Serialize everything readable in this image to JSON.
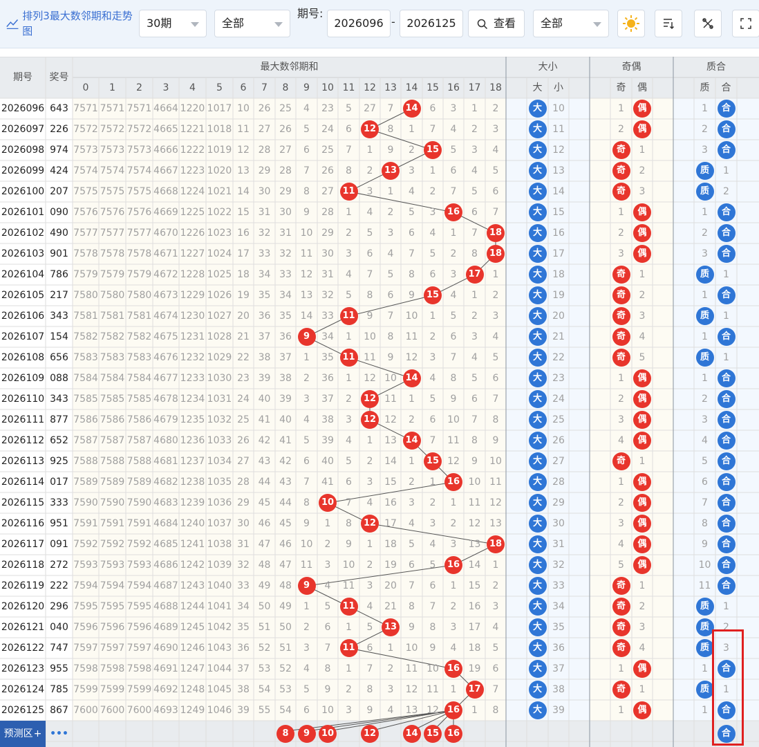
{
  "toolbar": {
    "title": "排列3最大数邻期和走势图",
    "period_select": "30期",
    "filter_select": "全部",
    "issue_label": "期号:",
    "issue_from": "2026096",
    "issue_to": "2026125",
    "dash": "-",
    "query_button": "查看",
    "filter_select2": "全部",
    "icons": [
      "sun-icon",
      "filter-list-icon",
      "shuffle-icon",
      "fullscreen-icon"
    ]
  },
  "header": {
    "col_issue": "期号",
    "col_prize": "奖号",
    "group_sum": "最大数邻期和",
    "group_size": "大小",
    "group_parity": "奇偶",
    "group_prime": "质合",
    "sum_cols": [
      "0",
      "1",
      "2",
      "3",
      "4",
      "5",
      "6",
      "7",
      "8",
      "9",
      "10",
      "11",
      "12",
      "13",
      "14",
      "15",
      "16",
      "17",
      "18"
    ],
    "size_cols": [
      "大",
      "小"
    ],
    "parity_cols": [
      "奇",
      "偶"
    ],
    "prime_cols": [
      "质",
      "合"
    ]
  },
  "colors": {
    "red": "#e8352c",
    "blue": "#2f76d6",
    "accent": "#3a6fd2"
  },
  "rows": [
    {
      "issue": "2026096",
      "prize": "643",
      "sums": [
        "7571",
        "7571",
        "7571",
        "4664",
        "1220",
        "1017",
        "10",
        "26",
        "25",
        "4",
        "23",
        "5",
        "27",
        "7",
        "14",
        "6",
        "3",
        "1",
        "2"
      ],
      "hit": 14,
      "size": [
        "大",
        "10"
      ],
      "parity": [
        "1",
        "偶"
      ],
      "prime": [
        "1",
        "合"
      ]
    },
    {
      "issue": "2026097",
      "prize": "226",
      "sums": [
        "7572",
        "7572",
        "7572",
        "4665",
        "1221",
        "1018",
        "11",
        "27",
        "26",
        "5",
        "24",
        "6",
        "12",
        "8",
        "1",
        "7",
        "4",
        "2",
        "3"
      ],
      "hit": 12,
      "size": [
        "大",
        "11"
      ],
      "parity": [
        "2",
        "偶"
      ],
      "prime": [
        "2",
        "合"
      ]
    },
    {
      "issue": "2026098",
      "prize": "974",
      "sums": [
        "7573",
        "7573",
        "7573",
        "4666",
        "1222",
        "1019",
        "12",
        "28",
        "27",
        "6",
        "25",
        "7",
        "1",
        "9",
        "2",
        "15",
        "5",
        "3",
        "4"
      ],
      "hit": 15,
      "size": [
        "大",
        "12"
      ],
      "parity": [
        "奇",
        "1"
      ],
      "prime": [
        "3",
        "合"
      ]
    },
    {
      "issue": "2026099",
      "prize": "424",
      "sums": [
        "7574",
        "7574",
        "7574",
        "4667",
        "1223",
        "1020",
        "13",
        "29",
        "28",
        "7",
        "26",
        "8",
        "2",
        "13",
        "3",
        "1",
        "6",
        "4",
        "5"
      ],
      "hit": 13,
      "size": [
        "大",
        "13"
      ],
      "parity": [
        "奇",
        "2"
      ],
      "prime": [
        "质",
        "1"
      ]
    },
    {
      "issue": "2026100",
      "prize": "207",
      "sums": [
        "7575",
        "7575",
        "7575",
        "4668",
        "1224",
        "1021",
        "14",
        "30",
        "29",
        "8",
        "27",
        "11",
        "3",
        "1",
        "4",
        "2",
        "7",
        "5",
        "6"
      ],
      "hit": 11,
      "size": [
        "大",
        "14"
      ],
      "parity": [
        "奇",
        "3"
      ],
      "prime": [
        "质",
        "2"
      ]
    },
    {
      "issue": "2026101",
      "prize": "090",
      "sums": [
        "7576",
        "7576",
        "7576",
        "4669",
        "1225",
        "1022",
        "15",
        "31",
        "30",
        "9",
        "28",
        "1",
        "4",
        "2",
        "5",
        "3",
        "16",
        "6",
        "7"
      ],
      "hit": 16,
      "size": [
        "大",
        "15"
      ],
      "parity": [
        "1",
        "偶"
      ],
      "prime": [
        "1",
        "合"
      ]
    },
    {
      "issue": "2026102",
      "prize": "490",
      "sums": [
        "7577",
        "7577",
        "7577",
        "4670",
        "1226",
        "1023",
        "16",
        "32",
        "31",
        "10",
        "29",
        "2",
        "5",
        "3",
        "6",
        "4",
        "1",
        "7",
        "18"
      ],
      "hit": 18,
      "size": [
        "大",
        "16"
      ],
      "parity": [
        "2",
        "偶"
      ],
      "prime": [
        "2",
        "合"
      ]
    },
    {
      "issue": "2026103",
      "prize": "901",
      "sums": [
        "7578",
        "7578",
        "7578",
        "4671",
        "1227",
        "1024",
        "17",
        "33",
        "32",
        "11",
        "30",
        "3",
        "6",
        "4",
        "7",
        "5",
        "2",
        "8",
        "18"
      ],
      "hit": 18,
      "size": [
        "大",
        "17"
      ],
      "parity": [
        "3",
        "偶"
      ],
      "prime": [
        "3",
        "合"
      ]
    },
    {
      "issue": "2026104",
      "prize": "786",
      "sums": [
        "7579",
        "7579",
        "7579",
        "4672",
        "1228",
        "1025",
        "18",
        "34",
        "33",
        "12",
        "31",
        "4",
        "7",
        "5",
        "8",
        "6",
        "3",
        "17",
        "1"
      ],
      "hit": 17,
      "size": [
        "大",
        "18"
      ],
      "parity": [
        "奇",
        "1"
      ],
      "prime": [
        "质",
        "1"
      ]
    },
    {
      "issue": "2026105",
      "prize": "217",
      "sums": [
        "7580",
        "7580",
        "7580",
        "4673",
        "1229",
        "1026",
        "19",
        "35",
        "34",
        "13",
        "32",
        "5",
        "8",
        "6",
        "9",
        "15",
        "4",
        "1",
        "2"
      ],
      "hit": 15,
      "size": [
        "大",
        "19"
      ],
      "parity": [
        "奇",
        "2"
      ],
      "prime": [
        "1",
        "合"
      ]
    },
    {
      "issue": "2026106",
      "prize": "343",
      "sums": [
        "7581",
        "7581",
        "7581",
        "4674",
        "1230",
        "1027",
        "20",
        "36",
        "35",
        "14",
        "33",
        "11",
        "9",
        "7",
        "10",
        "1",
        "5",
        "2",
        "3"
      ],
      "hit": 11,
      "size": [
        "大",
        "20"
      ],
      "parity": [
        "奇",
        "3"
      ],
      "prime": [
        "质",
        "1"
      ]
    },
    {
      "issue": "2026107",
      "prize": "154",
      "sums": [
        "7582",
        "7582",
        "7582",
        "4675",
        "1231",
        "1028",
        "21",
        "37",
        "36",
        "9",
        "34",
        "1",
        "10",
        "8",
        "11",
        "2",
        "6",
        "3",
        "4"
      ],
      "hit": 9,
      "size": [
        "大",
        "21"
      ],
      "parity": [
        "奇",
        "4"
      ],
      "prime": [
        "1",
        "合"
      ]
    },
    {
      "issue": "2026108",
      "prize": "656",
      "sums": [
        "7583",
        "7583",
        "7583",
        "4676",
        "1232",
        "1029",
        "22",
        "38",
        "37",
        "1",
        "35",
        "11",
        "11",
        "9",
        "12",
        "3",
        "7",
        "4",
        "5"
      ],
      "hit": 11,
      "size": [
        "大",
        "22"
      ],
      "parity": [
        "奇",
        "5"
      ],
      "prime": [
        "质",
        "1"
      ]
    },
    {
      "issue": "2026109",
      "prize": "088",
      "sums": [
        "7584",
        "7584",
        "7584",
        "4677",
        "1233",
        "1030",
        "23",
        "39",
        "38",
        "2",
        "36",
        "1",
        "12",
        "10",
        "14",
        "4",
        "8",
        "5",
        "6"
      ],
      "hit": 14,
      "size": [
        "大",
        "23"
      ],
      "parity": [
        "1",
        "偶"
      ],
      "prime": [
        "1",
        "合"
      ]
    },
    {
      "issue": "2026110",
      "prize": "343",
      "sums": [
        "7585",
        "7585",
        "7585",
        "4678",
        "1234",
        "1031",
        "24",
        "40",
        "39",
        "3",
        "37",
        "2",
        "12",
        "11",
        "1",
        "5",
        "9",
        "6",
        "7"
      ],
      "hit": 12,
      "size": [
        "大",
        "24"
      ],
      "parity": [
        "2",
        "偶"
      ],
      "prime": [
        "2",
        "合"
      ]
    },
    {
      "issue": "2026111",
      "prize": "877",
      "sums": [
        "7586",
        "7586",
        "7586",
        "4679",
        "1235",
        "1032",
        "25",
        "41",
        "40",
        "4",
        "38",
        "3",
        "12",
        "12",
        "2",
        "6",
        "10",
        "7",
        "8"
      ],
      "hit": 12,
      "size": [
        "大",
        "25"
      ],
      "parity": [
        "3",
        "偶"
      ],
      "prime": [
        "3",
        "合"
      ]
    },
    {
      "issue": "2026112",
      "prize": "652",
      "sums": [
        "7587",
        "7587",
        "7587",
        "4680",
        "1236",
        "1033",
        "26",
        "42",
        "41",
        "5",
        "39",
        "4",
        "1",
        "13",
        "14",
        "7",
        "11",
        "8",
        "9"
      ],
      "hit": 14,
      "size": [
        "大",
        "26"
      ],
      "parity": [
        "4",
        "偶"
      ],
      "prime": [
        "4",
        "合"
      ]
    },
    {
      "issue": "2026113",
      "prize": "925",
      "sums": [
        "7588",
        "7588",
        "7588",
        "4681",
        "1237",
        "1034",
        "27",
        "43",
        "42",
        "6",
        "40",
        "5",
        "2",
        "14",
        "1",
        "15",
        "12",
        "9",
        "10"
      ],
      "hit": 15,
      "size": [
        "大",
        "27"
      ],
      "parity": [
        "奇",
        "1"
      ],
      "prime": [
        "5",
        "合"
      ]
    },
    {
      "issue": "2026114",
      "prize": "017",
      "sums": [
        "7589",
        "7589",
        "7589",
        "4682",
        "1238",
        "1035",
        "28",
        "44",
        "43",
        "7",
        "41",
        "6",
        "3",
        "15",
        "2",
        "1",
        "16",
        "10",
        "11"
      ],
      "hit": 16,
      "size": [
        "大",
        "28"
      ],
      "parity": [
        "1",
        "偶"
      ],
      "prime": [
        "6",
        "合"
      ]
    },
    {
      "issue": "2026115",
      "prize": "333",
      "sums": [
        "7590",
        "7590",
        "7590",
        "4683",
        "1239",
        "1036",
        "29",
        "45",
        "44",
        "8",
        "10",
        "7",
        "4",
        "16",
        "3",
        "2",
        "1",
        "11",
        "12"
      ],
      "hit": 10,
      "size": [
        "大",
        "29"
      ],
      "parity": [
        "2",
        "偶"
      ],
      "prime": [
        "7",
        "合"
      ]
    },
    {
      "issue": "2026116",
      "prize": "951",
      "sums": [
        "7591",
        "7591",
        "7591",
        "4684",
        "1240",
        "1037",
        "30",
        "46",
        "45",
        "9",
        "1",
        "8",
        "12",
        "17",
        "4",
        "3",
        "2",
        "12",
        "13"
      ],
      "hit": 12,
      "size": [
        "大",
        "30"
      ],
      "parity": [
        "3",
        "偶"
      ],
      "prime": [
        "8",
        "合"
      ]
    },
    {
      "issue": "2026117",
      "prize": "091",
      "sums": [
        "7592",
        "7592",
        "7592",
        "4685",
        "1241",
        "1038",
        "31",
        "47",
        "46",
        "10",
        "2",
        "9",
        "1",
        "18",
        "5",
        "4",
        "3",
        "13",
        "18"
      ],
      "hit": 18,
      "size": [
        "大",
        "31"
      ],
      "parity": [
        "4",
        "偶"
      ],
      "prime": [
        "9",
        "合"
      ]
    },
    {
      "issue": "2026118",
      "prize": "272",
      "sums": [
        "7593",
        "7593",
        "7593",
        "4686",
        "1242",
        "1039",
        "32",
        "48",
        "47",
        "11",
        "3",
        "10",
        "2",
        "19",
        "6",
        "5",
        "16",
        "14",
        "1"
      ],
      "hit": 16,
      "size": [
        "大",
        "32"
      ],
      "parity": [
        "5",
        "偶"
      ],
      "prime": [
        "10",
        "合"
      ]
    },
    {
      "issue": "2026119",
      "prize": "222",
      "sums": [
        "7594",
        "7594",
        "7594",
        "4687",
        "1243",
        "1040",
        "33",
        "49",
        "48",
        "9",
        "4",
        "11",
        "3",
        "20",
        "7",
        "6",
        "1",
        "15",
        "2"
      ],
      "hit": 9,
      "size": [
        "大",
        "33"
      ],
      "parity": [
        "奇",
        "1"
      ],
      "prime": [
        "11",
        "合"
      ]
    },
    {
      "issue": "2026120",
      "prize": "296",
      "sums": [
        "7595",
        "7595",
        "7595",
        "4688",
        "1244",
        "1041",
        "34",
        "50",
        "49",
        "1",
        "5",
        "11",
        "4",
        "21",
        "8",
        "7",
        "2",
        "16",
        "3"
      ],
      "hit": 11,
      "size": [
        "大",
        "34"
      ],
      "parity": [
        "奇",
        "2"
      ],
      "prime": [
        "质",
        "1"
      ]
    },
    {
      "issue": "2026121",
      "prize": "040",
      "sums": [
        "7596",
        "7596",
        "7596",
        "4689",
        "1245",
        "1042",
        "35",
        "51",
        "50",
        "2",
        "6",
        "1",
        "5",
        "13",
        "9",
        "8",
        "3",
        "17",
        "4"
      ],
      "hit": 13,
      "size": [
        "大",
        "35"
      ],
      "parity": [
        "奇",
        "3"
      ],
      "prime": [
        "质",
        "2"
      ]
    },
    {
      "issue": "2026122",
      "prize": "747",
      "sums": [
        "7597",
        "7597",
        "7597",
        "4690",
        "1246",
        "1043",
        "36",
        "52",
        "51",
        "3",
        "7",
        "11",
        "6",
        "1",
        "10",
        "9",
        "4",
        "18",
        "5"
      ],
      "hit": 11,
      "size": [
        "大",
        "36"
      ],
      "parity": [
        "奇",
        "4"
      ],
      "prime": [
        "质",
        "3"
      ]
    },
    {
      "issue": "2026123",
      "prize": "955",
      "sums": [
        "7598",
        "7598",
        "7598",
        "4691",
        "1247",
        "1044",
        "37",
        "53",
        "52",
        "4",
        "8",
        "1",
        "7",
        "2",
        "11",
        "10",
        "16",
        "19",
        "6"
      ],
      "hit": 16,
      "size": [
        "大",
        "37"
      ],
      "parity": [
        "1",
        "偶"
      ],
      "prime": [
        "1",
        "合"
      ]
    },
    {
      "issue": "2026124",
      "prize": "785",
      "sums": [
        "7599",
        "7599",
        "7599",
        "4692",
        "1248",
        "1045",
        "38",
        "54",
        "53",
        "5",
        "9",
        "2",
        "8",
        "3",
        "12",
        "11",
        "1",
        "17",
        "7"
      ],
      "hit": 17,
      "size": [
        "大",
        "38"
      ],
      "parity": [
        "奇",
        "1"
      ],
      "prime": [
        "质",
        "1"
      ]
    },
    {
      "issue": "2026125",
      "prize": "867",
      "sums": [
        "7600",
        "7600",
        "7600",
        "4693",
        "1249",
        "1046",
        "39",
        "55",
        "54",
        "6",
        "10",
        "3",
        "9",
        "4",
        "13",
        "12",
        "16",
        "1",
        "8"
      ],
      "hit": 16,
      "size": [
        "大",
        "39"
      ],
      "parity": [
        "1",
        "偶"
      ],
      "prime": [
        "1",
        "合"
      ]
    }
  ],
  "prediction": {
    "label": "预测区",
    "plus": "+",
    "more": "•••",
    "balls": [
      "8",
      "9",
      "10",
      "12",
      "14",
      "15",
      "16"
    ],
    "prime_ball": "合"
  }
}
